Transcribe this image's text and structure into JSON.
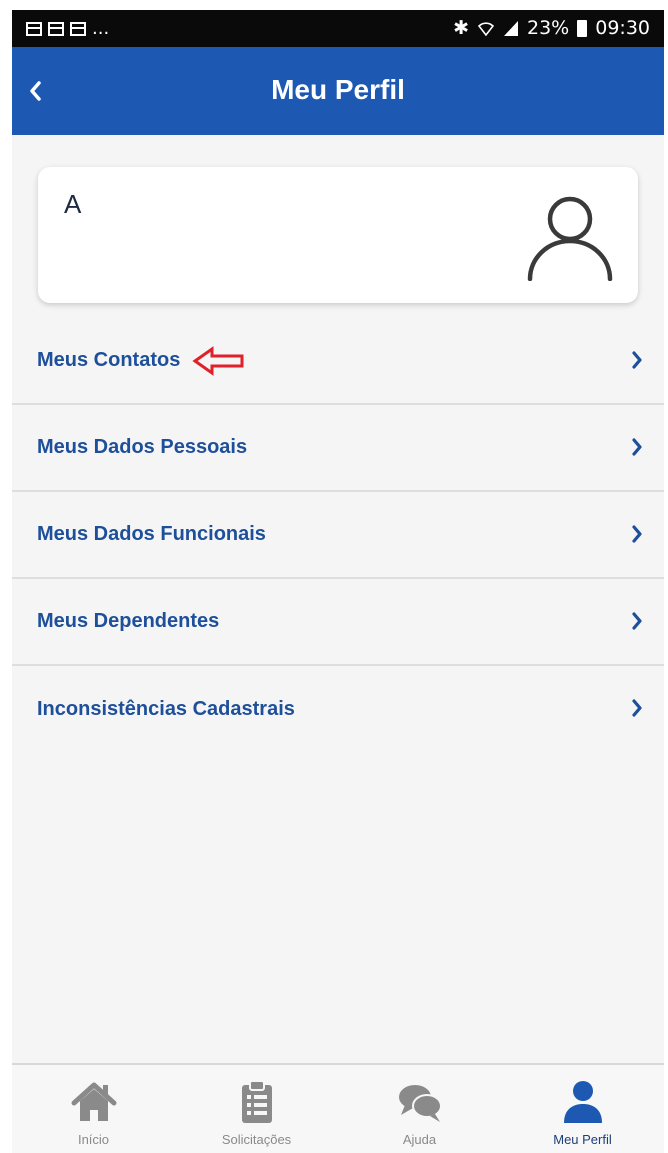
{
  "status_bar": {
    "left_more": "...",
    "battery": "23%",
    "time": "09:30"
  },
  "header": {
    "title": "Meu Perfil"
  },
  "profile": {
    "initial": "A"
  },
  "menu": [
    {
      "label": "Meus Contatos",
      "highlighted": true
    },
    {
      "label": "Meus Dados Pessoais"
    },
    {
      "label": "Meus Dados Funcionais"
    },
    {
      "label": "Meus Dependentes"
    },
    {
      "label": "Inconsistências Cadastrais"
    }
  ],
  "tabs": [
    {
      "label": "Início",
      "icon": "home-icon"
    },
    {
      "label": "Solicitações",
      "icon": "clipboard-list-icon"
    },
    {
      "label": "Ajuda",
      "icon": "chat-bubbles-icon"
    },
    {
      "label": "Meu Perfil",
      "icon": "user-icon",
      "active": true
    }
  ],
  "colors": {
    "primary": "#1d59b3",
    "menu_text": "#1e4f9a",
    "annotation_arrow": "#e0202a",
    "tab_active": "#1d59b3",
    "tab_inactive": "#8a8a8a"
  }
}
